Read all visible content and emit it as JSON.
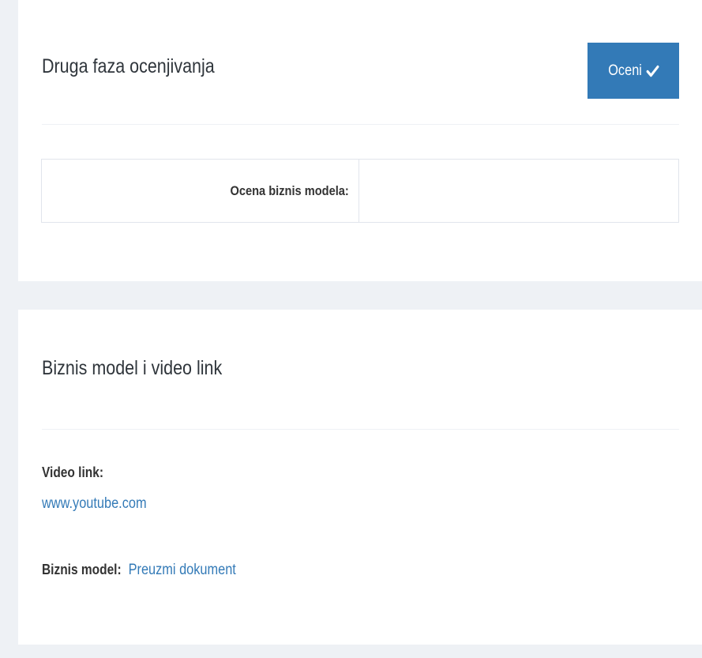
{
  "grading_panel": {
    "title": "Druga faza ocenjivanja",
    "rate_button_label": "Oceni",
    "table": {
      "label": "Ocena biznis modela:",
      "value": ""
    }
  },
  "business_panel": {
    "title": "Biznis model i video link",
    "video_link_label": "Video link:",
    "video_link_url": "www.youtube.com",
    "business_model_label": "Biznis model:",
    "business_model_link": "Preuzmi dokument"
  },
  "icons": {
    "rate_button_icon": "check-icon"
  },
  "colors": {
    "background": "#eef1f5",
    "panel": "#ffffff",
    "accent": "#337ab7",
    "text": "#333333"
  }
}
